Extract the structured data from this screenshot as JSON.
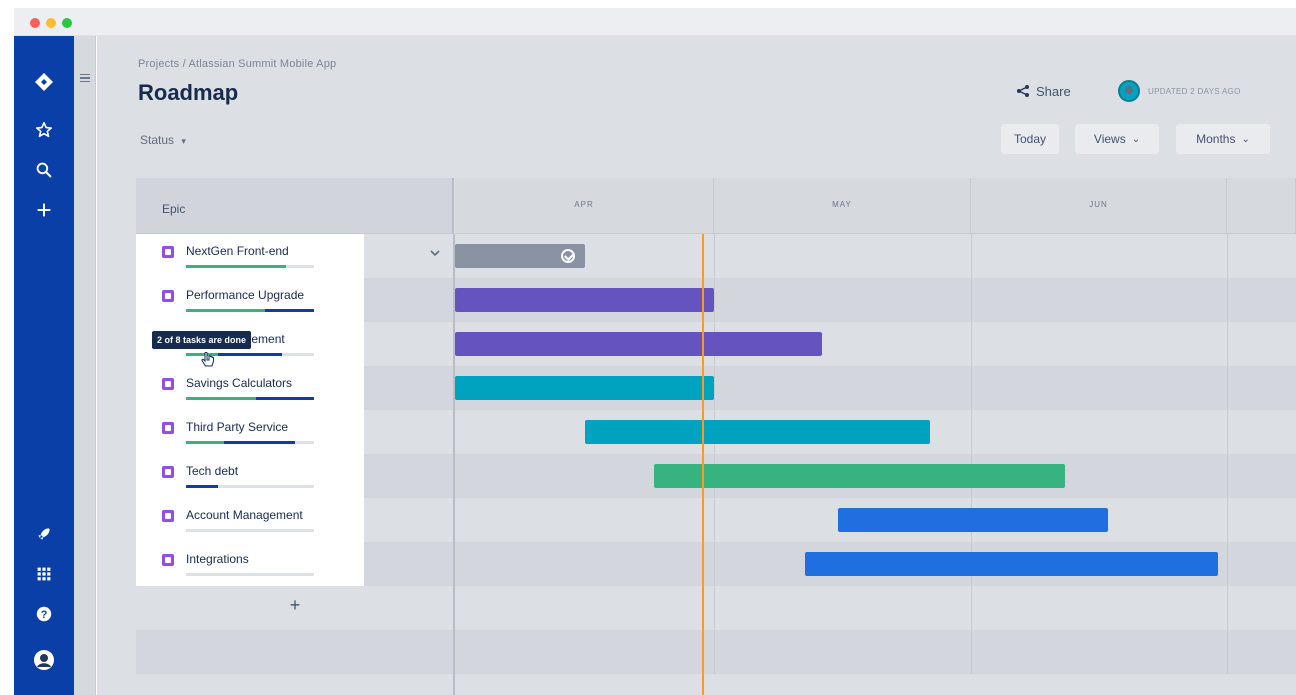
{
  "window": {
    "controls": [
      "close",
      "minimize",
      "maximize"
    ]
  },
  "global_nav": {
    "top_icons": [
      "jira-logo-icon",
      "star-icon",
      "search-icon",
      "plus-icon"
    ],
    "bottom_icons": [
      "rocket-icon",
      "app-switcher-icon",
      "help-icon",
      "profile-avatar-icon"
    ]
  },
  "header": {
    "breadcrumb": "Projects / Atlassian Summit Mobile App",
    "title": "Roadmap",
    "status_filter": "Status",
    "share_label": "Share",
    "updated_text": "UPDATED 2 DAYS AGO"
  },
  "toolbar": {
    "today_label": "Today",
    "views_label": "Views",
    "months_label": "Months"
  },
  "timeline": {
    "epic_column_header": "Epic",
    "months": [
      "APR",
      "MAY",
      "JUN"
    ],
    "today_marker": "today"
  },
  "epics": [
    {
      "name": "NextGen Front-end",
      "progress_done": 0.78,
      "progress_in_progress": 0.0,
      "bar_color": "#8993a4",
      "start": "Apr 1",
      "end": "Apr 16",
      "completed": true,
      "expanded": true
    },
    {
      "name": "Performance Upgrade",
      "progress_done": 0.62,
      "progress_in_progress": 0.38,
      "bar_color": "#6554c0",
      "start": "Apr 1",
      "end": "May 1"
    },
    {
      "name": "Tech Improvement",
      "progress_done": 0.25,
      "progress_in_progress": 0.5,
      "bar_color": "#6554c0",
      "start": "Apr 1",
      "end": "May 14"
    },
    {
      "name": "Savings Calculators",
      "progress_done": 0.55,
      "progress_in_progress": 0.45,
      "bar_color": "#00a3bf",
      "start": "Apr 1",
      "end": "May 1"
    },
    {
      "name": "Third Party Service",
      "progress_done": 0.3,
      "progress_in_progress": 0.55,
      "bar_color": "#00a3bf",
      "start": "Apr 16",
      "end": "May 27"
    },
    {
      "name": "Tech debt",
      "progress_done": 0.0,
      "progress_in_progress": 0.25,
      "bar_color": "#36b37e",
      "start": "Apr 24",
      "end": "Jun 12"
    },
    {
      "name": "Account Management",
      "progress_done": 0.0,
      "progress_in_progress": 0.0,
      "bar_color": "#1f6fe0",
      "start": "May 16",
      "end": "Jun 17"
    },
    {
      "name": "Integrations",
      "progress_done": 0.0,
      "progress_in_progress": 0.0,
      "bar_color": "#1f6fe0",
      "start": "May 12",
      "end": "Jun 30"
    }
  ],
  "tooltip": {
    "text": "2 of 8 tasks are done"
  },
  "add_epic_label": "+"
}
